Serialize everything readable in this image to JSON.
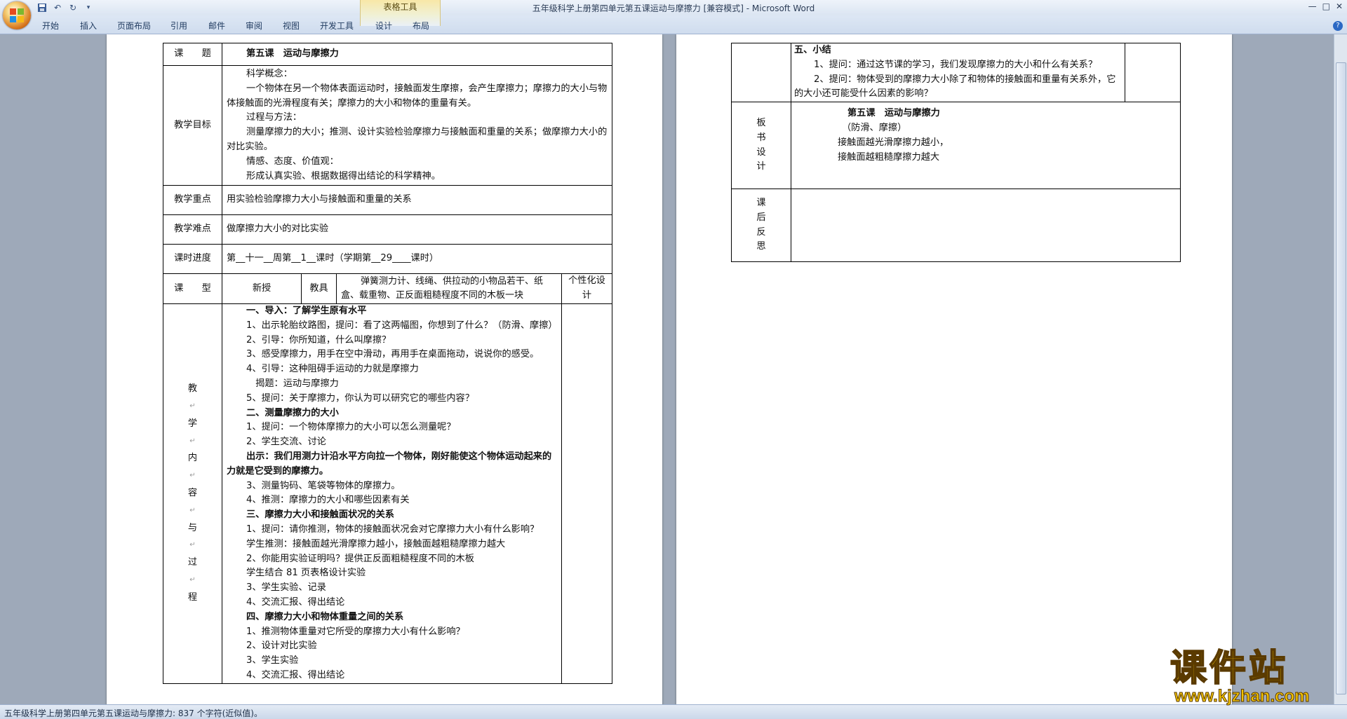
{
  "window": {
    "title": "五年级科学上册第四单元第五课运动与摩擦力 [兼容模式] - Microsoft Word",
    "contextual_group": "表格工具",
    "tabs": [
      "开始",
      "插入",
      "页面布局",
      "引用",
      "邮件",
      "审阅",
      "视图",
      "开发工具",
      "设计",
      "布局"
    ],
    "help_label": "?"
  },
  "qat": {
    "save_icon": "save-icon",
    "undo_icon": "undo-icon",
    "redo_icon": "redo-icon",
    "customize_icon": "dropdown-icon"
  },
  "status": {
    "text": "五年级科学上册第四单元第五课运动与摩擦力: 837 个字符(近似值)。"
  },
  "watermark": {
    "cn": "课件站",
    "url": "www.kjzhan.com"
  },
  "page1": {
    "subject_label": "课　　题",
    "subject_value": "第五课　运动与摩擦力",
    "goals_label": "教学目标",
    "goals": [
      "科学概念：",
      "一个物体在另一个物体表面运动时，接触面发生摩擦，会产生摩擦力；摩擦力的大小与物体接触面的光滑程度有关；摩擦力的大小和物体的重量有关。",
      "过程与方法：",
      "测量摩擦力的大小；推测、设计实验检验摩擦力与接触面和重量的关系；做摩擦力大小的对比实验。",
      "情感、态度、价值观：",
      "形成认真实验、根据数据得出结论的科学精神。"
    ],
    "key_label": "教学重点",
    "key_value": "用实验检验摩擦力大小与接触面和重量的关系",
    "difficulty_label": "教学难点",
    "difficulty_value": "做摩擦力大小的对比实验",
    "progress_label": "课时进度",
    "progress_value": "第__十一__周第__1__课时（学期第__29____课时）",
    "type_label": "课　　型",
    "type_value": "新授",
    "tools_label": "教具",
    "tools_value": "弹簧测力计、线绳、供拉动的小物品若干、纸盒、载重物、正反面粗糙程度不同的木板一块",
    "personal_label": "个性化设计",
    "process_label": [
      "教",
      "学",
      "内",
      "容",
      "与",
      "过",
      "程"
    ],
    "process": [
      {
        "t": "一、导入：了解学生原有水平",
        "b": true
      },
      {
        "t": "1、出示轮胎纹路图，提问：看了这两幅图，你想到了什么？（防滑、摩擦）",
        "b": false
      },
      {
        "t": "2、引导：你所知道，什么叫摩擦？",
        "b": false
      },
      {
        "t": "3、感受摩擦力，用手在空中滑动，再用手在桌面拖动，说说你的感受。",
        "b": false
      },
      {
        "t": "4、引导：这种阻碍手运动的力就是摩擦力",
        "b": false
      },
      {
        "t": "　揭题：运动与摩擦力",
        "b": false
      },
      {
        "t": "5、提问：关于摩擦力，你认为可以研究它的哪些内容？",
        "b": false
      },
      {
        "t": "二、测量摩擦力的大小",
        "b": true
      },
      {
        "t": "1、提问：一个物体摩擦力的大小可以怎么测量呢？",
        "b": false
      },
      {
        "t": "2、学生交流、讨论",
        "b": false
      },
      {
        "t": "出示：我们用测力计沿水平方向拉一个物体，刚好能使这个物体运动起来的力就是它受到的摩擦力。",
        "b": true
      },
      {
        "t": "3、测量钩码、笔袋等物体的摩擦力。",
        "b": false
      },
      {
        "t": "4、推测：摩擦力的大小和哪些因素有关",
        "b": false
      },
      {
        "t": "三、摩擦力大小和接触面状况的关系",
        "b": true
      },
      {
        "t": "1、提问：请你推测，物体的接触面状况会对它摩擦力大小有什么影响？",
        "b": false
      },
      {
        "t": "学生推测：接触面越光滑摩擦力越小，接触面越粗糙摩擦力越大",
        "b": false
      },
      {
        "t": "2、你能用实验证明吗？提供正反面粗糙程度不同的木板",
        "b": false
      },
      {
        "t": "学生结合 81 页表格设计实验",
        "b": false
      },
      {
        "t": "3、学生实验、记录",
        "b": false
      },
      {
        "t": "4、交流汇报、得出结论",
        "b": false
      },
      {
        "t": "四、摩擦力大小和物体重量之间的关系",
        "b": true
      },
      {
        "t": "1、推测物体重量对它所受的摩擦力大小有什么影响？",
        "b": false
      },
      {
        "t": "2、设计对比实验",
        "b": false
      },
      {
        "t": "3、学生实验",
        "b": false
      },
      {
        "t": "4、交流汇报、得出结论",
        "b": false
      }
    ]
  },
  "page2": {
    "summary_title": "五、小结",
    "summary_items": [
      "1、提问：通过这节课的学习，我们发现摩擦力的大小和什么有关系？",
      "2、提问：物体受到的摩擦力大小除了和物体的接触面和重量有关系外，它的大小还可能受什么因素的影响？"
    ],
    "board_label": [
      "板",
      "书",
      "设",
      "计"
    ],
    "board_title": "第五课　运动与摩擦力",
    "board_lines": [
      "（防滑、摩擦）",
      "接触面越光滑摩擦力越小，",
      "接触面越粗糙摩擦力越大"
    ],
    "reflect_label": [
      "课",
      "后",
      "反",
      "思"
    ]
  }
}
